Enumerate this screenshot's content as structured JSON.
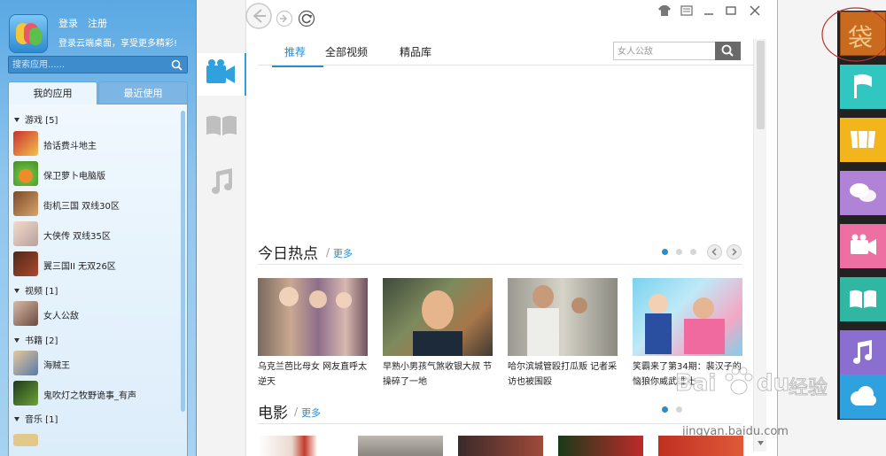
{
  "left_panel": {
    "login": "登录",
    "register": "注册",
    "promo": "登录云端桌面，享受更多精彩!",
    "search_placeholder": "搜索应用......",
    "tab_my_apps": "我的应用",
    "tab_recent": "最近使用",
    "categories": [
      {
        "name": "游戏 [5]"
      },
      {
        "name": "视频 [1]"
      },
      {
        "name": "书籍 [2]"
      },
      {
        "name": "音乐 [1]"
      }
    ],
    "apps": [
      {
        "name": "拾话费斗地主",
        "icon": "doudizhu-app-icon"
      },
      {
        "name": "保卫萝卜电脑版",
        "icon": "carrot-app-icon"
      },
      {
        "name": "街机三国 双线30区",
        "icon": "sanguo-app-icon"
      },
      {
        "name": "大侠传 双线35区",
        "icon": "daxia-app-icon"
      },
      {
        "name": "翼三国II 无双26区",
        "icon": "yisanguo-app-icon"
      },
      {
        "name": "女人公敌",
        "icon": "video-app-icon"
      },
      {
        "name": "海贼王",
        "icon": "onepiece-app-icon"
      },
      {
        "name": "鬼吹灯之牧野诡事_有声",
        "icon": "ghost-book-app-icon"
      }
    ]
  },
  "main": {
    "tabs": [
      "推荐",
      "全部视频",
      "精品库"
    ],
    "search_placeholder": "女人公敌",
    "hot_title": "今日热点",
    "hot_more": "更多",
    "slash": "/",
    "movie_title": "电影",
    "movie_more": "更多",
    "cards": [
      {
        "caption": "乌克兰芭比母女 网友直呼太逆天"
      },
      {
        "caption": "早熟小男孩气煞收银大叔 节操碎了一地"
      },
      {
        "caption": "哈尔滨城管殴打瓜贩 记者采访也被围殴"
      },
      {
        "caption": "笑霸来了第34期：裴汉子的恼狼你威武雄壮"
      }
    ]
  },
  "right_bar": {
    "logo_char": "袋"
  },
  "watermark": {
    "brand": "Bai",
    "brand2": "du",
    "jingyan": "经验",
    "url": "jingyan.baidu.com"
  },
  "colors": {
    "accent": "#2a8bd0",
    "left_panel_blue": "#5aa8e3",
    "right_bar": [
      "#c96a1e",
      "#31c7c0",
      "#f3b51c",
      "#b083d6",
      "#ee6fa2",
      "#2fb7a3",
      "#8b6fd0",
      "#2ea1de"
    ]
  }
}
